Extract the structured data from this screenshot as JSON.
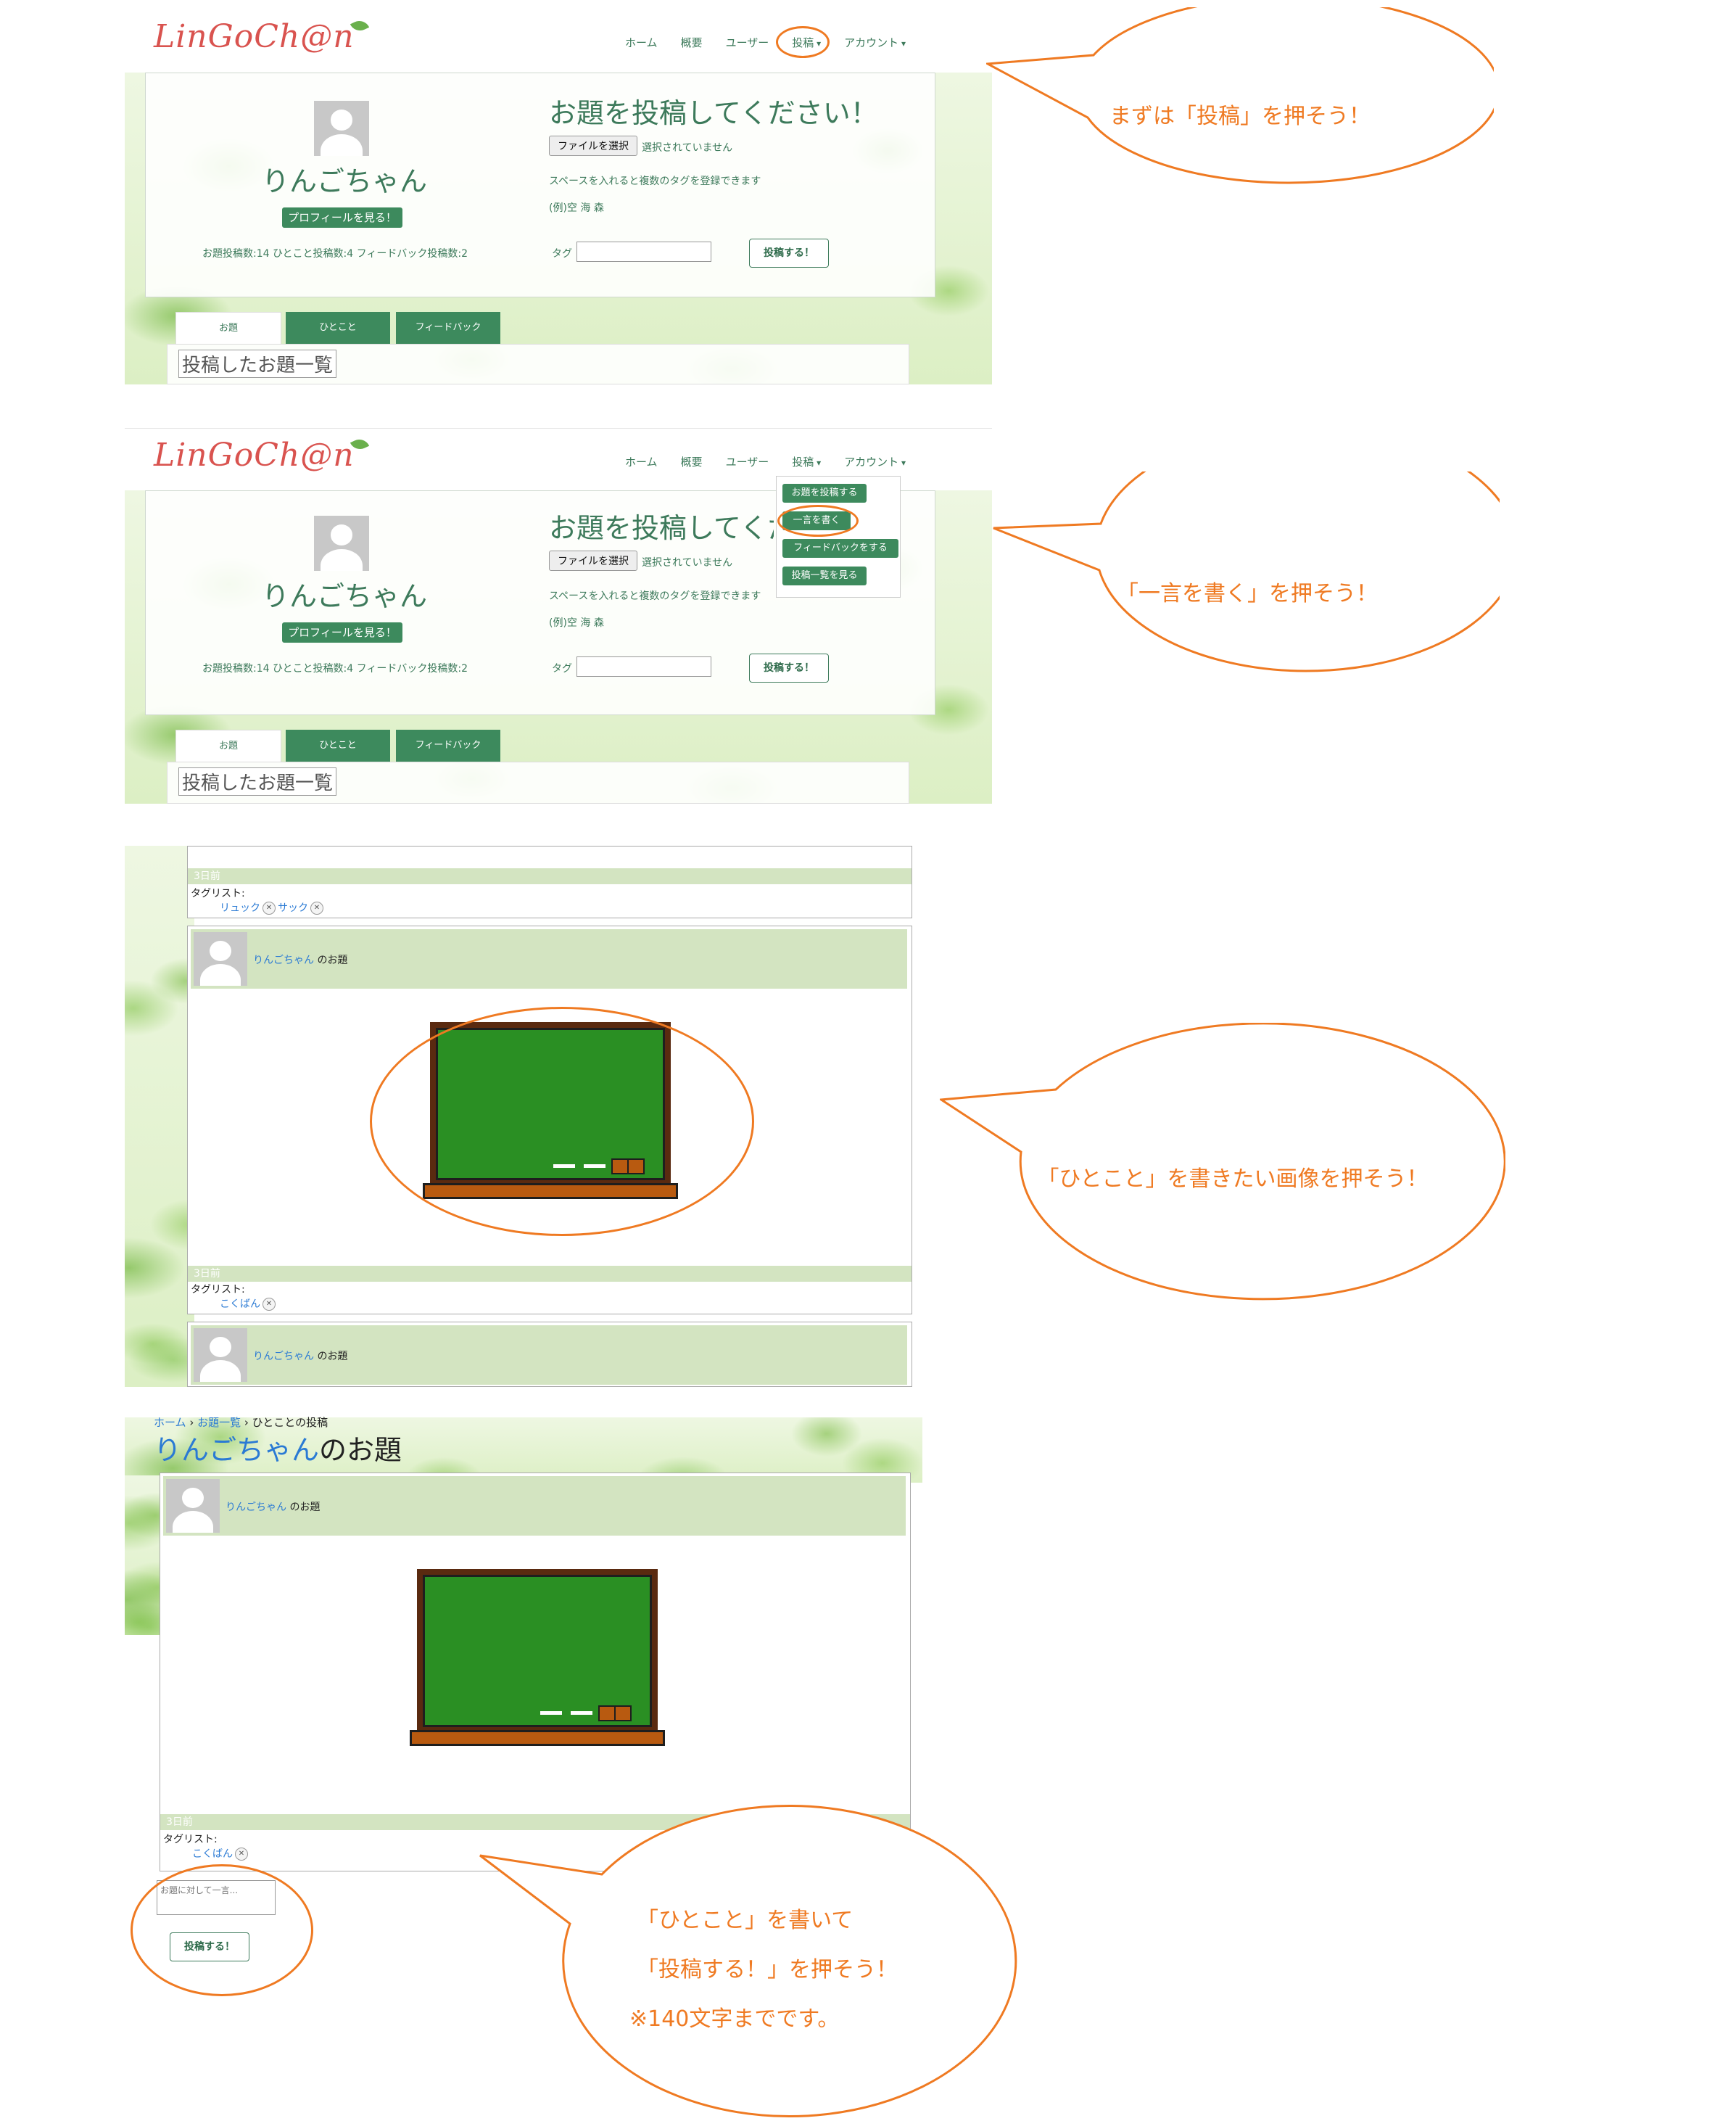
{
  "app": {
    "logo": "LinGoCh@n"
  },
  "nav": {
    "home": "ホーム",
    "about": "概要",
    "users": "ユーザー",
    "post": "投稿",
    "account": "アカウント"
  },
  "profile": {
    "name": "りんごちゃん",
    "view_profile": "プロフィールを見る！",
    "stats": "お題投稿数:14 ひとこと投稿数:4 フィードバック投稿数:2"
  },
  "post_form": {
    "heading": "お題を投稿してください！",
    "file_button": "ファイルを選択",
    "file_status": "選択されていません",
    "hint": "スペースを入れると複数のタグを登録できます",
    "example": "(例)空 海 森",
    "tag_label": "タグ",
    "submit": "投稿する！"
  },
  "tabs": {
    "topics": "お題",
    "hitokoto": "ひとこと",
    "feedback": "フィードバック"
  },
  "list_title": "投稿したお題一覧",
  "dropdown": {
    "post_topic": "お題を投稿する",
    "write_hitokoto": "一言を書く",
    "give_feedback": "フィードバックをする",
    "view_posts": "投稿一覧を見る"
  },
  "feed": {
    "date": "3日前",
    "tag_list_label": "タグリスト:",
    "tags_a": [
      "リュック",
      "サック"
    ],
    "tags_b": [
      "こくばん"
    ],
    "author": "りんごちゃん",
    "author_suffix": "のお題"
  },
  "detail": {
    "breadcrumb_home": "ホーム",
    "breadcrumb_list": "お題一覧",
    "breadcrumb_current": "ひとことの投稿",
    "title_name": "りんごちゃん",
    "title_suffix": "のお題",
    "comment_placeholder": "お題に対して一言...",
    "submit": "投稿する！"
  },
  "callouts": {
    "step1": "まずは「投稿」を押そう！",
    "step2": "「一言を書く」を押そう！",
    "step3": "「ひとこと」を書きたい画像を押そう！",
    "step4_line1": "「ひとこと」を書いて",
    "step4_line2": "「投稿する！」を押そう！",
    "step4_line3": "※140文字までです。"
  },
  "colors": {
    "accent_orange": "#ef7a22",
    "brand_green": "#3d8a5d",
    "logo_red": "#d9534f",
    "post_header_green": "#d3e4c1"
  }
}
